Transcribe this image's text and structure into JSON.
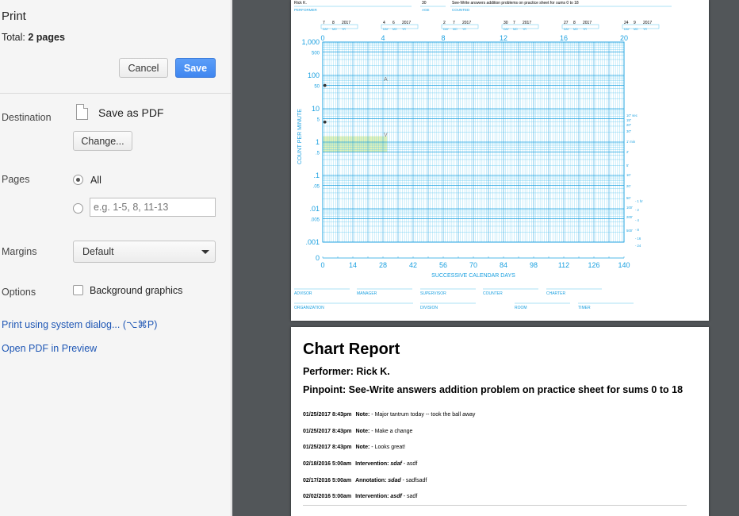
{
  "panel": {
    "title": "Print",
    "total_label": "Total:",
    "total_value": "2 pages",
    "cancel_label": "Cancel",
    "save_label": "Save",
    "destination_label": "Destination",
    "destination_value": "Save as PDF",
    "change_label": "Change...",
    "pages_label": "Pages",
    "pages_all_label": "All",
    "pages_range_placeholder": "e.g. 1-5, 8, 11-13",
    "margins_label": "Margins",
    "margins_value": "Default",
    "options_label": "Options",
    "background_graphics_label": "Background graphics",
    "background_graphics_checked": false,
    "pages_selected": "All",
    "system_dialog_link": "Print using system dialog... (⌥⌘P)",
    "open_pdf_link": "Open PDF in Preview"
  },
  "chart_page": {
    "performer": "Rick K.",
    "performer_caption": "PERFORMER",
    "age": "30",
    "age_caption": "AGE",
    "counted": "See-Write answers addition problems on practice sheet for sums 0 to 18",
    "counted_caption": "COUNTED",
    "date_captions": [
      "DAY",
      "MO",
      "YR"
    ],
    "dates": [
      {
        "day": "7",
        "month": "8",
        "year": "2017"
      },
      {
        "day": "4",
        "month": "6",
        "year": "2017"
      },
      {
        "day": "2",
        "month": "7",
        "year": "2017"
      },
      {
        "day": "30",
        "month": "7",
        "year": "2017"
      },
      {
        "day": "27",
        "month": "8",
        "year": "2017"
      },
      {
        "day": "24",
        "month": "9",
        "year": "2017"
      }
    ],
    "top_week_ticks": [
      "0",
      "4",
      "8",
      "12",
      "16",
      "20"
    ],
    "bottom_day_ticks": [
      "0",
      "14",
      "28",
      "42",
      "56",
      "70",
      "84",
      "98",
      "112",
      "126",
      "140"
    ],
    "y_ticks": [
      "1,000",
      "500",
      "100",
      "50",
      "10",
      "5",
      "1",
      ".5",
      ".1",
      ".05",
      ".01",
      ".005",
      ".001",
      "0"
    ],
    "y_label": "COUNT PER MINUTE",
    "x_label": "SUCCESSIVE CALENDAR DAYS",
    "right_labels": [
      "10\" sec",
      "15\"",
      "20\"",
      "30\"",
      "1' min",
      "2'",
      "5'",
      "10'",
      "20'",
      "50'",
      "100'",
      "200'",
      "500'",
      "- 1 hr",
      "- 2",
      "- 4",
      "- 8",
      "- 16",
      "- 24"
    ],
    "footer_row1": [
      "ADVISOR",
      "MANAGER",
      "SUPERVISOR",
      "COUNTER",
      "CHARTER"
    ],
    "footer_row2": [
      "ORGANIZATION",
      "DIVISION",
      "ROOM",
      "TIMER"
    ],
    "aim_up_marker": "A",
    "aim_down_marker": "V"
  },
  "chart_data": {
    "type": "scatter",
    "title": "",
    "xlabel": "SUCCESSIVE CALENDAR DAYS",
    "ylabel": "COUNT PER MINUTE",
    "x_range": [
      0,
      140
    ],
    "y_range": [
      0.001,
      1000
    ],
    "y_scale": "log",
    "grid": true,
    "series": [
      {
        "name": "",
        "x": [
          1,
          1
        ],
        "y": [
          50,
          4
        ]
      }
    ],
    "aim_band": {
      "x": [
        0,
        30
      ],
      "y": [
        0.5,
        1.5
      ],
      "color": "#e2f2b8"
    }
  },
  "report": {
    "title": "Chart Report",
    "performer_line": "Performer: Rick K.",
    "pinpoint_line": "Pinpoint: See-Write answers addition problem on practice sheet for sums 0 to 18",
    "notes": [
      {
        "date": "01/25/2017 8:43pm",
        "kind": "Note:",
        "tag": "",
        "text": "- Major tantrum today -- took the ball away"
      },
      {
        "date": "01/25/2017 8:43pm",
        "kind": "Note:",
        "tag": "",
        "text": "- Make a change"
      },
      {
        "date": "01/25/2017 8:43pm",
        "kind": "Note:",
        "tag": "",
        "text": "- Looks great!"
      },
      {
        "date": "02/18/2016 5:00am",
        "kind": "Intervention:",
        "tag": "sdaf",
        "text": "- asdf"
      },
      {
        "date": "02/17/2016 5:00am",
        "kind": "Annotation:",
        "tag": "sdad",
        "text": "- sadfsadf"
      },
      {
        "date": "02/02/2016 5:00am",
        "kind": "Intervention:",
        "tag": "asdf",
        "text": "- sadf"
      }
    ]
  },
  "colors": {
    "grid": "#58c4ee",
    "grid_dark": "#1aa0e0",
    "accent_link": "#1f57b5",
    "save_button": "#4a90f5",
    "preview_bg": "#525659"
  }
}
